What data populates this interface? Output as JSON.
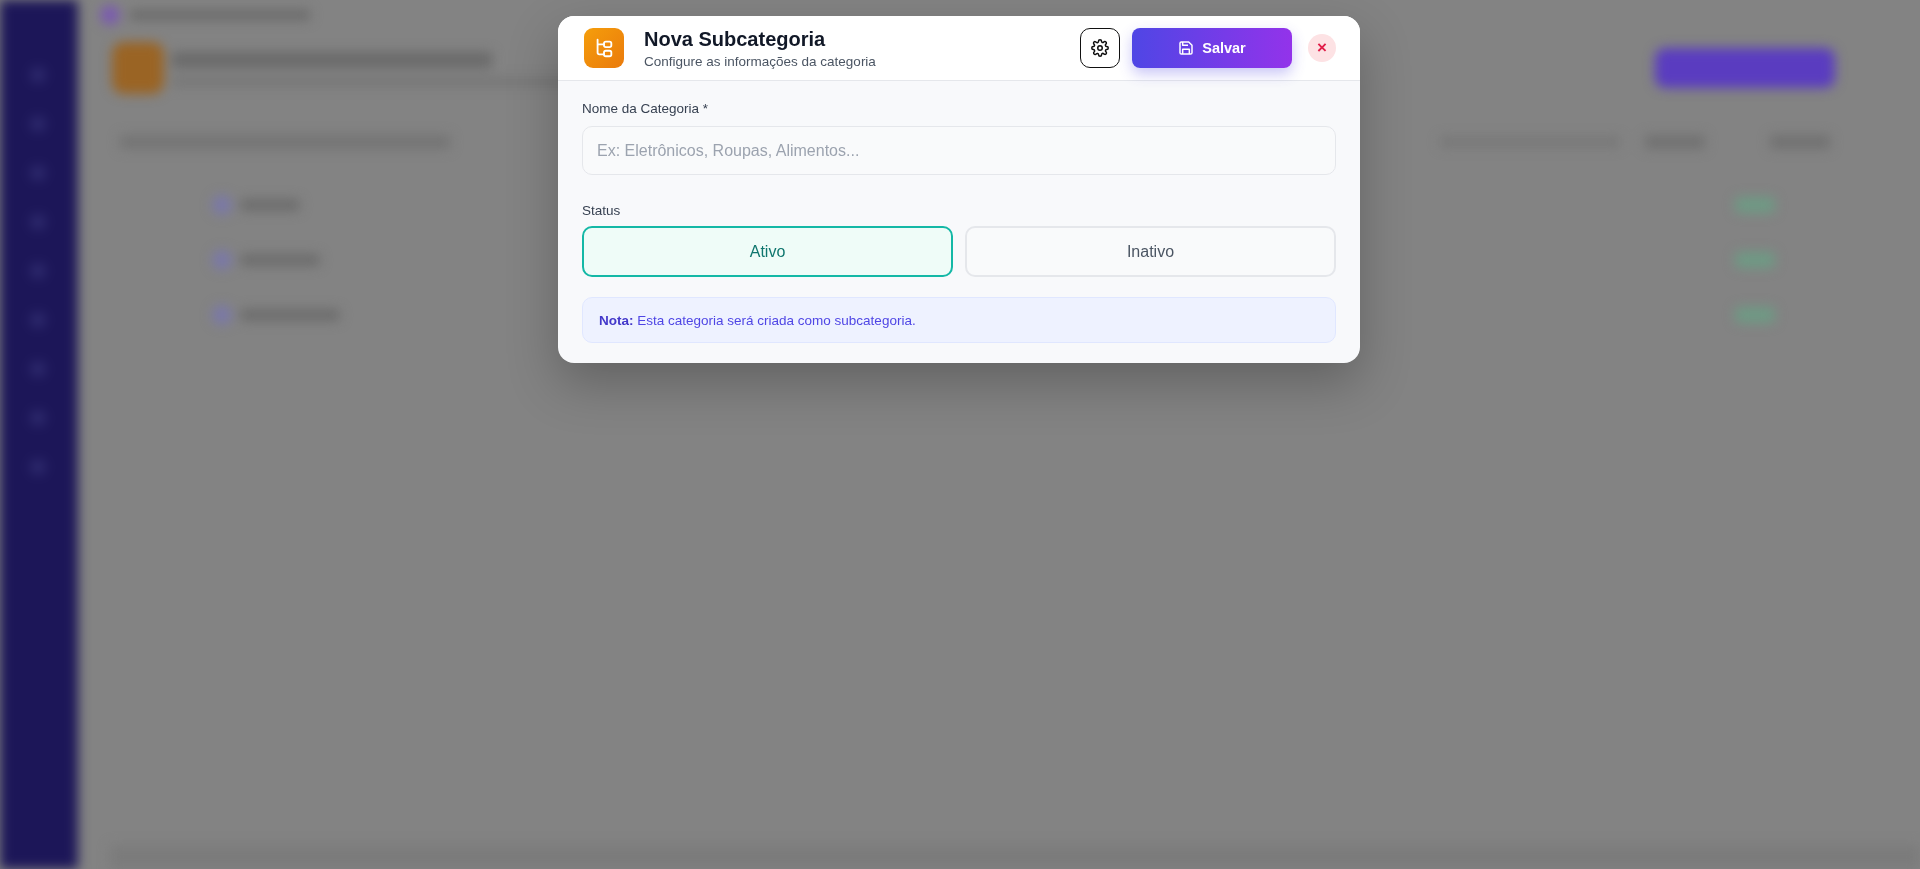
{
  "modal": {
    "title": "Nova Subcategoria",
    "subtitle": "Configure as informações da categoria",
    "save_button": "Salvar",
    "close_button": "×",
    "name_field": {
      "label": "Nome da Categoria *",
      "placeholder": "Ex: Eletrônicos, Roupas, Alimentos..."
    },
    "status": {
      "label": "Status",
      "options": [
        {
          "label": "Ativo",
          "selected": true
        },
        {
          "label": "Inativo",
          "selected": false
        }
      ]
    },
    "note": "**Nota:** Esta categoria será criada como subcategoria."
  }
}
